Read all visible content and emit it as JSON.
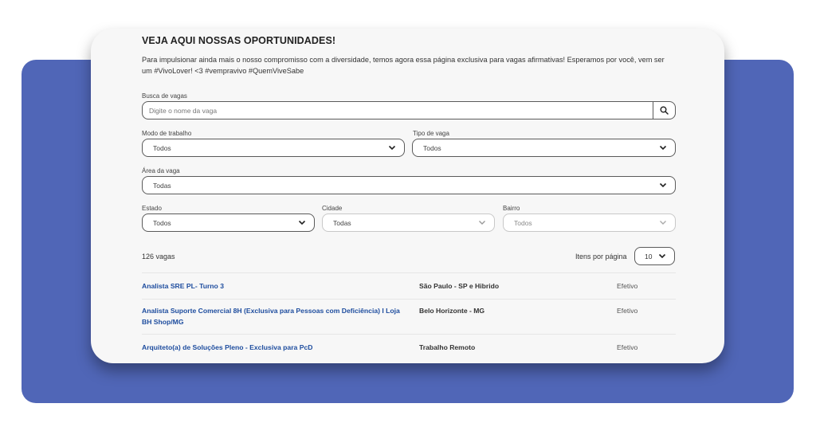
{
  "page": {
    "title": "VEJA AQUI NOSSAS OPORTUNIDADES!",
    "description": "Para impulsionar ainda mais o nosso compromisso com a diversidade, temos agora essa página exclusiva para vagas afirmativas! Esperamos por você, vem ser um #VivoLover! <3 #vempravivo #QuemViveSabe"
  },
  "search": {
    "label": "Busca de vagas",
    "placeholder": "Digite o nome da vaga",
    "value": "",
    "icon": "search-icon"
  },
  "filters": {
    "modo": {
      "label": "Modo de trabalho",
      "value": "Todos"
    },
    "tipo": {
      "label": "Tipo de vaga",
      "value": "Todos"
    },
    "area": {
      "label": "Área da vaga",
      "value": "Todas"
    },
    "estado": {
      "label": "Estado",
      "value": "Todos"
    },
    "cidade": {
      "label": "Cidade",
      "value": "Todas"
    },
    "bairro": {
      "label": "Bairro",
      "value": "Todos"
    }
  },
  "results": {
    "count": "126 vagas",
    "per_page_label": "Itens por página",
    "per_page": "10"
  },
  "jobs": [
    {
      "title": "Analista SRE PL- Turno 3",
      "location": "São Paulo - SP e Hibrido",
      "type": "Efetivo"
    },
    {
      "title": "Analista Suporte Comercial 8H (Exclusiva para Pessoas com Deficiência) I Loja BH Shop/MG",
      "location": "Belo Horizonte - MG",
      "type": "Efetivo"
    },
    {
      "title": "Arquiteto(a) de Soluções Pleno - Exclusiva para PcD",
      "location": "Trabalho Remoto",
      "type": "Efetivo"
    }
  ],
  "colors": {
    "accent_panel": "#5066b7",
    "link": "#1d4c9e",
    "card": "#f7f7f7"
  }
}
